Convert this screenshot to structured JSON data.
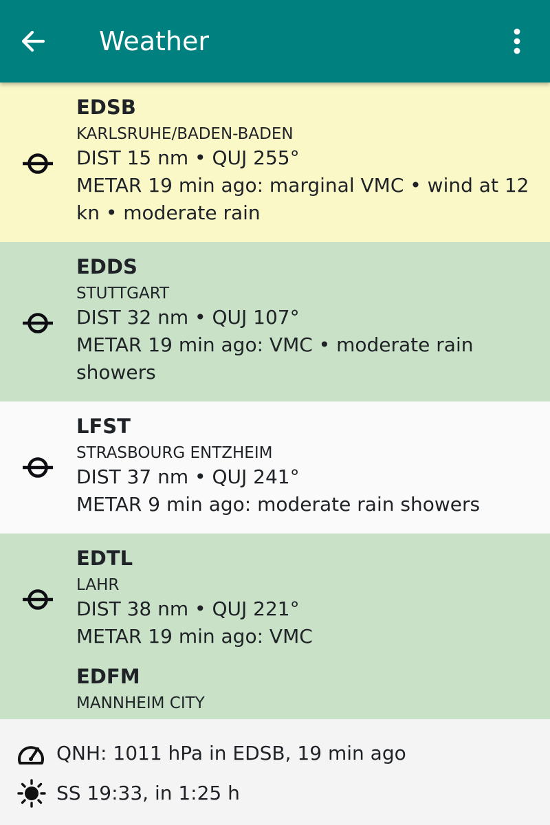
{
  "appbar": {
    "title": "Weather",
    "back_icon": "arrow-left-icon",
    "menu_icon": "more-vertical-icon"
  },
  "colors": {
    "appbar": "#00807f",
    "marginal": "#fbf8c8",
    "vmc": "#c8e1c7",
    "neutral": "#fafafa"
  },
  "stations": [
    {
      "code": "EDSB",
      "name": "KARLSRUHE/BADEN-BADEN",
      "dist": "DIST 15 nm • QUJ 255°",
      "metar": [
        "METAR 19 min ago: marginal VMC • wind at 12",
        "kn • moderate rain"
      ],
      "status": "marginal",
      "icon": "airfield-icon"
    },
    {
      "code": "EDDS",
      "name": "STUTTGART",
      "dist": "DIST 32 nm • QUJ 107°",
      "metar": [
        "METAR 19 min ago: VMC • moderate rain",
        "showers"
      ],
      "status": "vmc",
      "icon": "airfield-icon"
    },
    {
      "code": "LFST",
      "name": "STRASBOURG ENTZHEIM",
      "dist": "DIST 37 nm • QUJ 241°",
      "metar": [
        "METAR 9 min ago: moderate rain showers"
      ],
      "status": "neutral",
      "icon": "airfield-icon"
    },
    {
      "code": "EDTL",
      "name": "LAHR",
      "dist": "DIST 38 nm • QUJ 221°",
      "metar": [
        "METAR 19 min ago: VMC"
      ],
      "status": "vmc",
      "icon": "airfield-icon"
    },
    {
      "code": "EDFM",
      "name": "MANNHEIM CITY",
      "dist": "",
      "metar": [],
      "status": "vmc",
      "icon": "airfield-icon"
    }
  ],
  "bottom": {
    "qnh": {
      "text": "QNH: 1011 hPa in EDSB, 19 min ago",
      "icon": "speedometer-icon"
    },
    "sun": {
      "text": "SS 19:33, in 1:25 h",
      "icon": "sun-icon"
    }
  }
}
